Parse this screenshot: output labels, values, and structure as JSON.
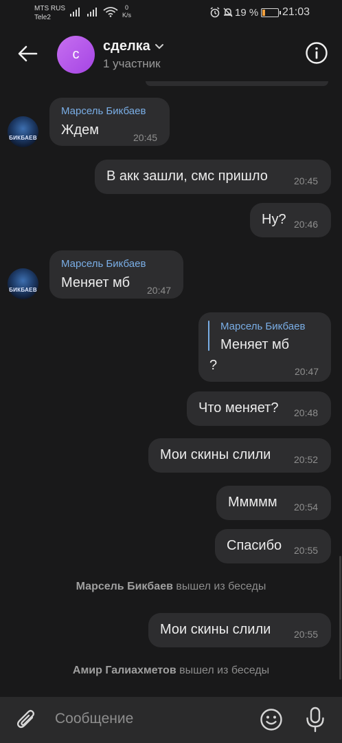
{
  "status_bar": {
    "carrier_1": "MTS RUS",
    "carrier_2": "Tele2",
    "net_speed_value": "0",
    "net_speed_unit": "K/s",
    "battery_percent": "19 %",
    "battery_level": 0.19,
    "time": "21:03"
  },
  "header": {
    "avatar_letter": "с",
    "title": "сделка",
    "subtitle": "1 участник",
    "avatar_color": "#b55cea"
  },
  "peer_avatar_text": "БИКБАЕВ",
  "messages": [
    {
      "sender": "Марсель Бикбаев",
      "text": "Ждем",
      "time": "20:45"
    },
    {
      "text": "В акк зашли, смс пришло",
      "time": "20:45"
    },
    {
      "text": "Ну?",
      "time": "20:46"
    },
    {
      "sender": "Марсель Бикбаев",
      "text": "Меняет мб",
      "time": "20:47"
    },
    {
      "reply_sender": "Марсель Бикбаев",
      "reply_text": "Меняет мб",
      "text": "?",
      "time": "20:47"
    },
    {
      "text": "Что меняет?",
      "time": "20:48"
    },
    {
      "text": "Мои скины слили",
      "time": "20:52"
    },
    {
      "text": "Ммммм",
      "time": "20:54"
    },
    {
      "text": "Спасибо",
      "time": "20:55"
    },
    {
      "text": "Мои скины слили",
      "time": "20:55"
    }
  ],
  "service_messages": [
    {
      "name": "Марсель Бикбаев",
      "action": "вышел из беседы"
    },
    {
      "name": "Амир Галиахметов",
      "action": "вышел из беседы"
    }
  ],
  "input": {
    "placeholder": "Сообщение"
  },
  "colors": {
    "background": "#19191a",
    "bubble": "#2d2d2f",
    "sender_name": "#7aaee6",
    "battery_low": "#f2a03d"
  }
}
